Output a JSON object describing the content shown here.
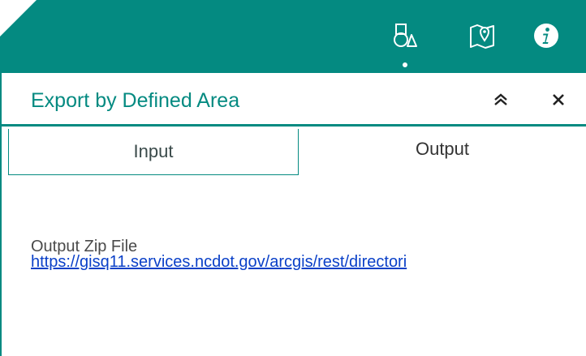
{
  "header": {
    "buttons": [
      {
        "icon": "shapes-icon",
        "active": true
      },
      {
        "icon": "map-icon",
        "active": false
      },
      {
        "icon": "info-icon",
        "active": false
      }
    ],
    "bar_color": "#048a81"
  },
  "panel": {
    "title": "Export by Defined Area",
    "collapse_icon": "double-chevron-up-icon",
    "close_icon": "close-icon",
    "tabs": [
      {
        "label": "Input",
        "selected": false
      },
      {
        "label": "Output",
        "selected": true
      }
    ],
    "output": {
      "label": "Output Zip File",
      "link_text": "https://gisq11.services.ncdot.gov/arcgis/rest/directori"
    }
  },
  "colors": {
    "accent": "#048a81",
    "link": "#0a40c8"
  }
}
